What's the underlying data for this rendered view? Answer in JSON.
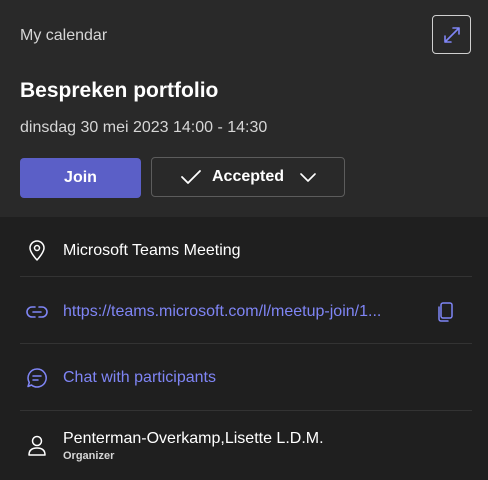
{
  "header": {
    "calendar_label": "My calendar",
    "title": "Bespreken portfolio",
    "datetime": "dinsdag 30 mei 2023 14:00 - 14:30",
    "join_label": "Join",
    "accepted_label": "Accepted"
  },
  "details": {
    "location": "Microsoft Teams Meeting",
    "meeting_link": "https://teams.microsoft.com/l/meetup-join/1...",
    "chat_label": "Chat with participants",
    "organizer_name": "Penterman-Overkamp,Lisette L.D.M.",
    "organizer_role": "Organizer"
  },
  "colors": {
    "accent": "#5b5fc7",
    "link": "#7f85f5",
    "header_bg": "#292929",
    "details_bg": "#1f1f1f"
  },
  "icons": [
    "expand-icon",
    "checkmark-icon",
    "chevron-down-icon",
    "location-pin-icon",
    "link-icon",
    "copy-icon",
    "chat-icon",
    "person-icon"
  ]
}
